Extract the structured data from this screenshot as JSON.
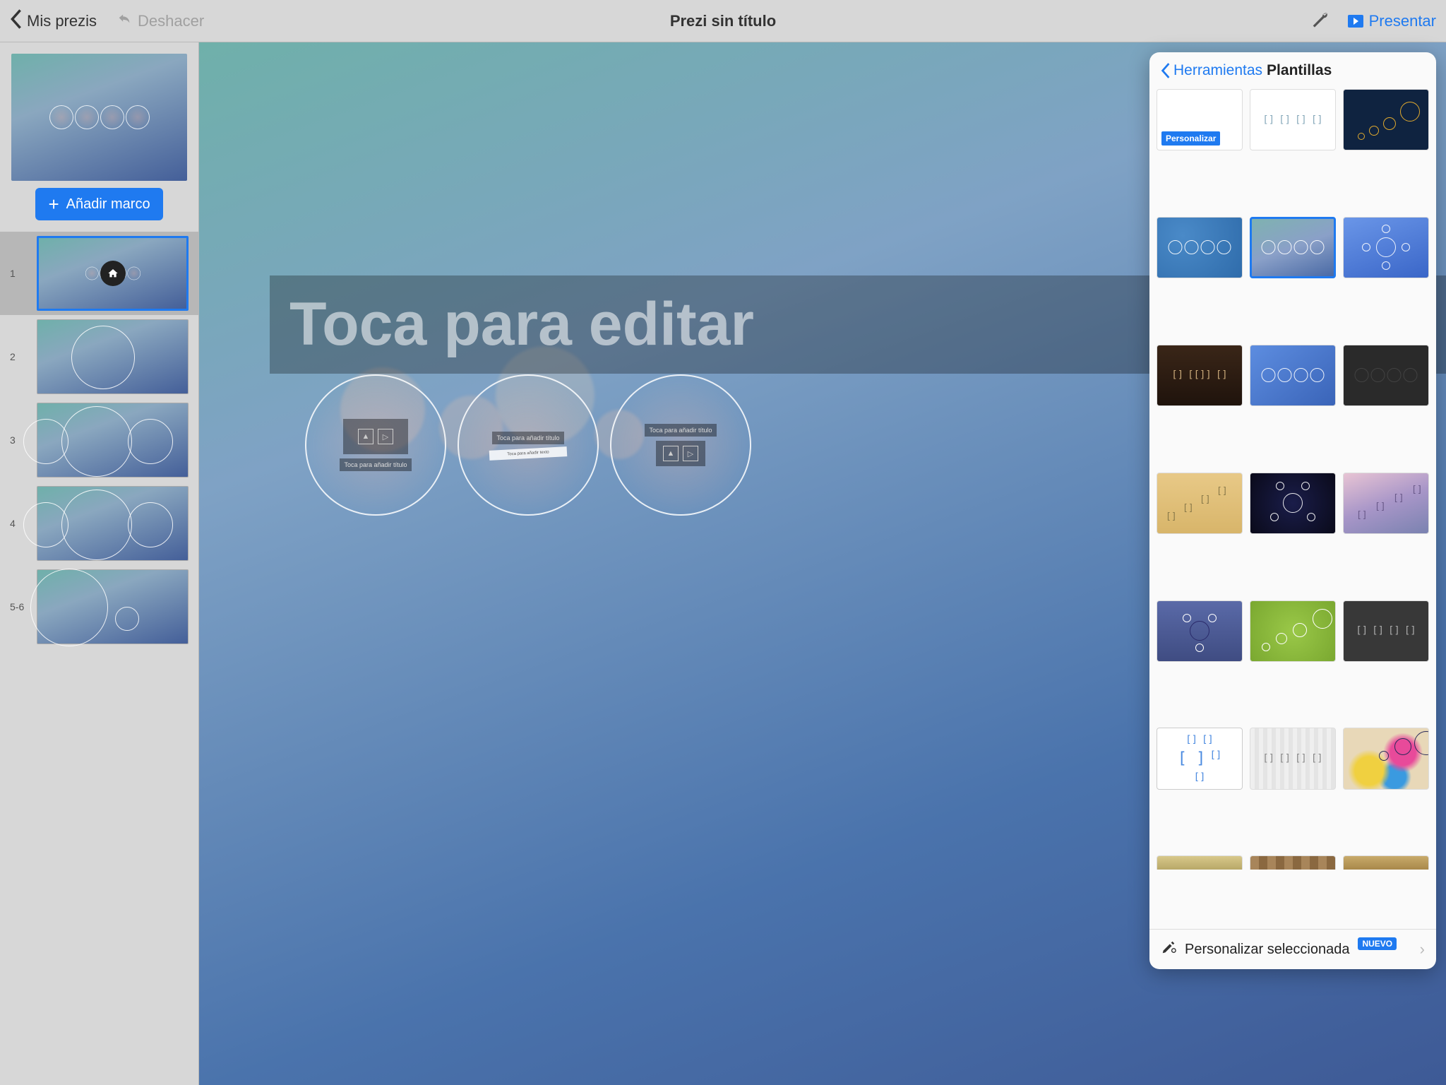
{
  "toolbar": {
    "back_label": "Mis prezis",
    "undo_label": "Deshacer",
    "title": "Prezi sin título",
    "present_label": "Presentar"
  },
  "sidebar": {
    "add_frame_label": "Añadir marco",
    "frames": [
      {
        "num": "1"
      },
      {
        "num": "2"
      },
      {
        "num": "3"
      },
      {
        "num": "4"
      },
      {
        "num": "5-6"
      }
    ]
  },
  "canvas": {
    "edit_title_placeholder": "Toca para editar",
    "frame_title_placeholder": "Toca para añadir título",
    "frame_text_placeholder": "Toca para añadir texto"
  },
  "popover": {
    "back_label": "Herramientas",
    "title": "Plantillas",
    "customize_badge": "Personalizar",
    "footer_label": "Personalizar seleccionada",
    "footer_badge": "NUEVO"
  }
}
